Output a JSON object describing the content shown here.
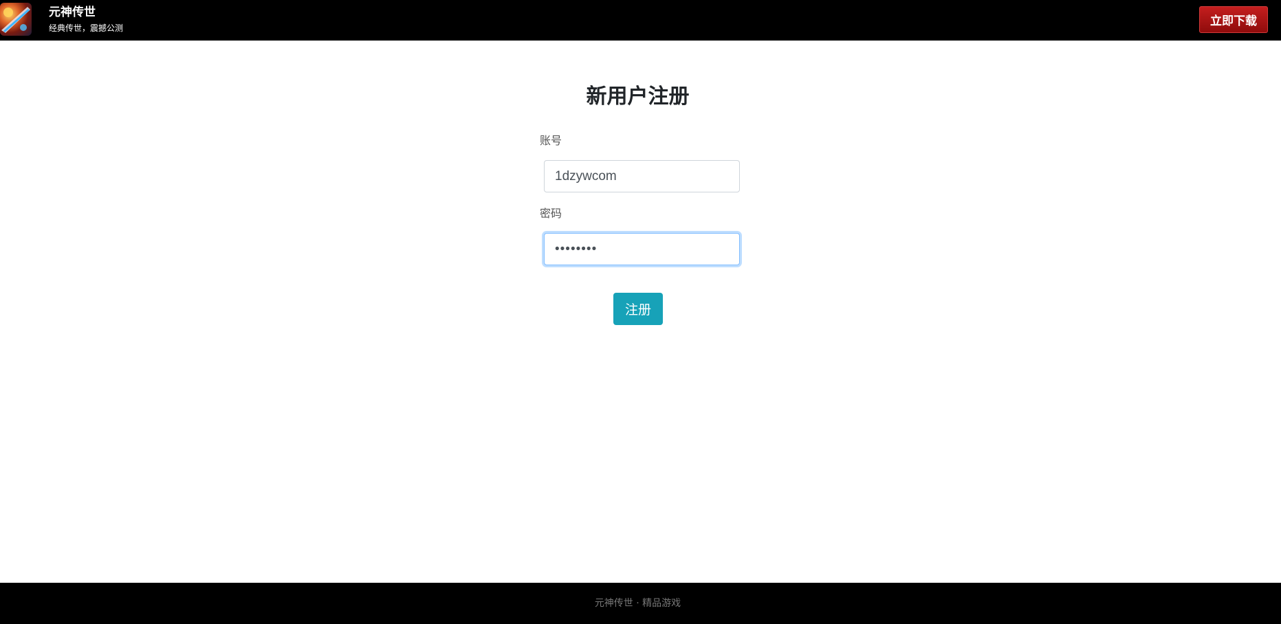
{
  "header": {
    "logo_icon": "game-logo-icon",
    "title": "元神传世",
    "subtitle": "经典传世，震撼公测",
    "download_label": "立即下载"
  },
  "form": {
    "title": "新用户注册",
    "account_label": "账号",
    "account_value": "1dzywcom",
    "password_label": "密码",
    "password_value": "12345678",
    "submit_label": "注册"
  },
  "footer": {
    "text": "元神传世 · 精品游戏"
  },
  "colors": {
    "header_bg": "#000000",
    "download_button": "#b31313",
    "submit_button": "#17a2b8",
    "focus_ring": "#80bdff"
  }
}
